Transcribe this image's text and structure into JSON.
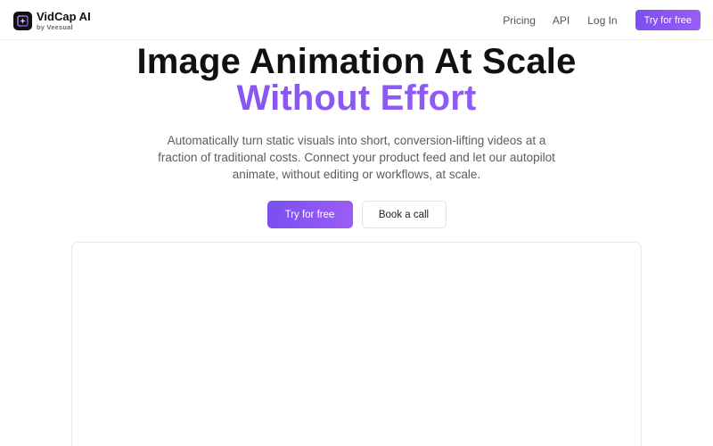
{
  "brand": {
    "name": "VidCap AI",
    "sub": "by Veesual",
    "logo_icon": "sparkle-frame-icon"
  },
  "nav": {
    "links": [
      "Pricing",
      "API",
      "Log In"
    ],
    "cta": "Try for free"
  },
  "hero": {
    "headline_line1": "Image Animation At Scale",
    "headline_line2": "Without Effort",
    "subtitle": "Automatically turn static visuals into short, conversion-lifting videos at a fraction of traditional costs. Connect your product feed and let our autopilot animate, without editing or workflows, at scale.",
    "primary_cta": "Try for free",
    "secondary_cta": "Book a call"
  },
  "colors": {
    "accent_start": "#7b4ff0",
    "accent_end": "#9b5cf6",
    "text": "#111111",
    "muted": "#5c5c5c"
  }
}
